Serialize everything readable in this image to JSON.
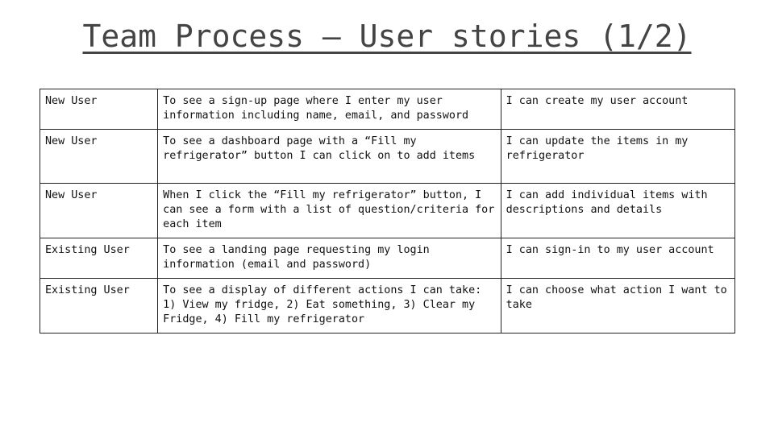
{
  "slide": {
    "title": "Team Process – User stories (1/2)"
  },
  "table": {
    "rows": [
      {
        "role": "New User",
        "want": "To see a sign-up page where I enter my user information including name, email, and password",
        "benefit": "I can create my user account"
      },
      {
        "role": "New User",
        "want": "To see a dashboard page with a “Fill my refrigerator” button I can click on to add items",
        "benefit": "I can update the items in my refrigerator"
      },
      {
        "role": "New User",
        "want": "When I click the “Fill my refrigerator” button, I can see a form with a list of question/criteria for each item",
        "benefit": "I can add individual items with descriptions and details"
      },
      {
        "role": "Existing User",
        "want": "To see a landing page requesting my login information (email and password)",
        "benefit": "I can sign-in to my user account"
      },
      {
        "role": "Existing User",
        "want": "To see a display of different actions I can take: 1) View my fridge, 2) Eat something, 3) Clear my Fridge, 4) Fill my refrigerator",
        "benefit": "I can choose what action I want to take"
      }
    ]
  }
}
